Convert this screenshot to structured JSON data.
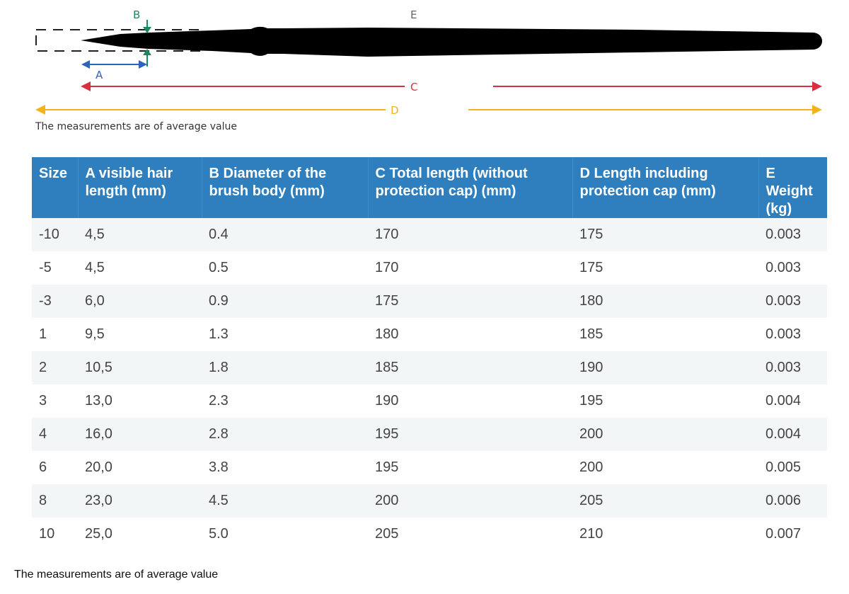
{
  "diagram": {
    "label_a": "A",
    "label_b": "B",
    "label_c": "C",
    "label_d": "D",
    "label_e": "E",
    "note": "The measurements are of average value",
    "colors": {
      "a": "#2e63b8",
      "b": "#1b8a5a",
      "c": "#d9303f",
      "d": "#f3b41b",
      "brush": "#000000"
    }
  },
  "table": {
    "headers": [
      "Size",
      "A visible hair length (mm)",
      "B Diameter of the brush body (mm)",
      "C Total length (without protection cap) (mm)",
      "D Length including protection cap (mm)",
      "E Weight (kg)"
    ],
    "rows": [
      [
        "-10",
        "4,5",
        "0.4",
        "170",
        "175",
        "0.003"
      ],
      [
        "-5",
        "4,5",
        "0.5",
        "170",
        "175",
        "0.003"
      ],
      [
        "-3",
        "6,0",
        "0.9",
        "175",
        "180",
        "0.003"
      ],
      [
        "1",
        "9,5",
        "1.3",
        "180",
        "185",
        "0.003"
      ],
      [
        "2",
        "10,5",
        "1.8",
        "185",
        "190",
        "0.003"
      ],
      [
        "3",
        "13,0",
        "2.3",
        "190",
        "195",
        "0.004"
      ],
      [
        "4",
        "16,0",
        "2.8",
        "195",
        "200",
        "0.004"
      ],
      [
        "6",
        "20,0",
        "3.8",
        "195",
        "200",
        "0.005"
      ],
      [
        "8",
        "23,0",
        "4.5",
        "200",
        "205",
        "0.006"
      ],
      [
        "10",
        "25,0",
        "5.0",
        "205",
        "210",
        "0.007"
      ]
    ],
    "header_color": "#2f7fbf",
    "stripe_color": "#f3f6f6"
  },
  "footer": {
    "note": "The measurements are of average value"
  }
}
